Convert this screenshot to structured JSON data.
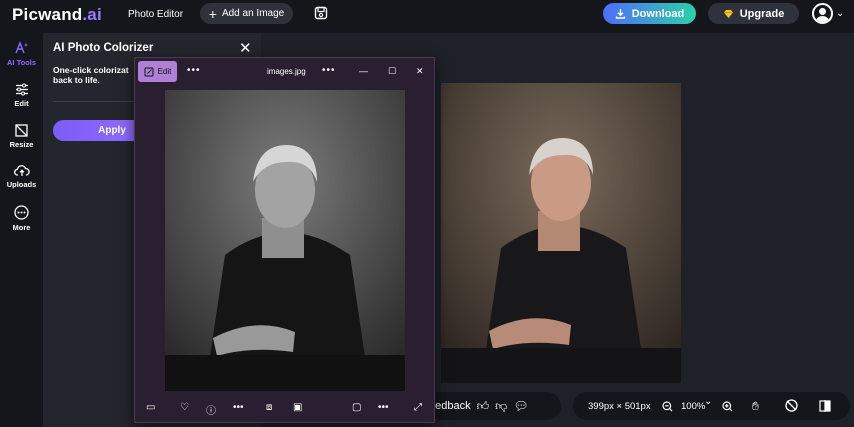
{
  "topbar": {
    "logo_main": "Picwand",
    "logo_suffix": ".ai",
    "nav_photo_editor": "Photo Editor",
    "add_image_label": "Add an Image",
    "download_label": "Download",
    "upgrade_label": "Upgrade"
  },
  "sidebar": {
    "items": [
      {
        "label": "AI Tools",
        "icon": "ai-tools-icon",
        "active": true
      },
      {
        "label": "Edit",
        "icon": "sliders-icon"
      },
      {
        "label": "Resize",
        "icon": "resize-icon"
      },
      {
        "label": "Uploads",
        "icon": "cloud-upload-icon"
      },
      {
        "label": "More",
        "icon": "more-circle-icon"
      }
    ]
  },
  "panel": {
    "title": "AI Photo Colorizer",
    "description_line1": "One-click colorizat",
    "description_line2": "back to life.",
    "apply_label": "Apply"
  },
  "viewer": {
    "edit_label": "Edit",
    "filename": "images.jpg"
  },
  "bottombar": {
    "feedback_label": "eedback",
    "dimensions": "399px × 501px",
    "zoom": "100%"
  },
  "colors": {
    "accent": "#8f6bff",
    "download_gradient_start": "#4f6dfc",
    "download_gradient_end": "#2ad1a6",
    "viewer_edit_bg": "#b07fd6"
  }
}
